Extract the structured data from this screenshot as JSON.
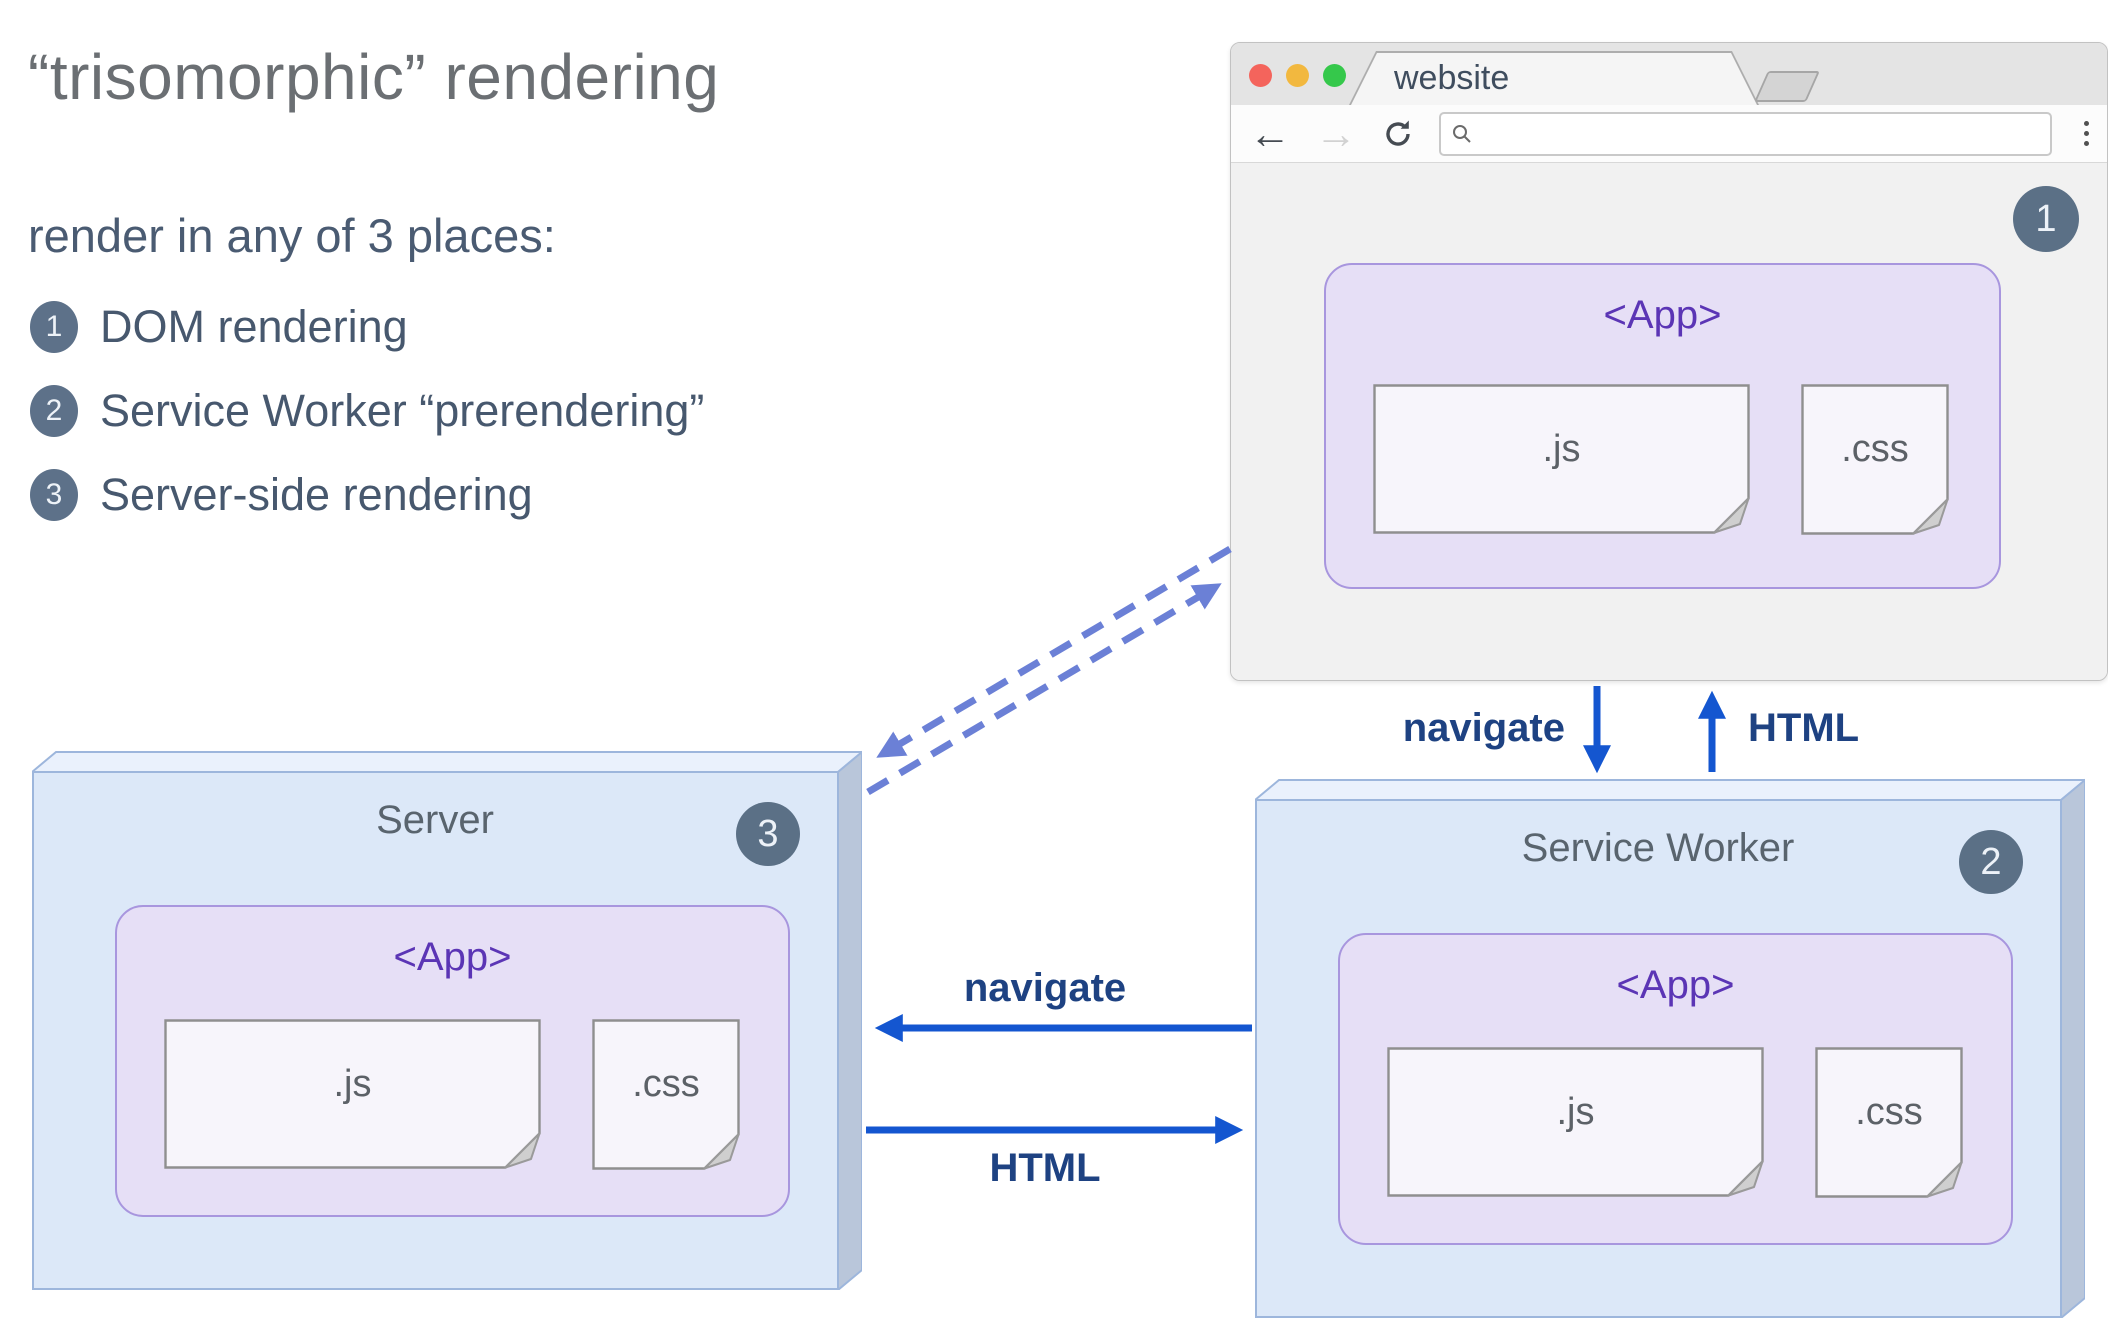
{
  "slide": {
    "title": "“trisomorphic” rendering",
    "intro": "render in any of 3 places:"
  },
  "legend": [
    {
      "num": "1",
      "label": "DOM rendering"
    },
    {
      "num": "2",
      "label": "Service Worker “prerendering”"
    },
    {
      "num": "3",
      "label": "Server-side rendering"
    }
  ],
  "browser": {
    "tab_title": "website",
    "badge": "1",
    "app": {
      "label": "<App>",
      "js": ".js",
      "css": ".css"
    }
  },
  "server": {
    "title": "Server",
    "badge": "3",
    "app": {
      "label": "<App>",
      "js": ".js",
      "css": ".css"
    }
  },
  "service_worker": {
    "title": "Service Worker",
    "badge": "2",
    "app": {
      "label": "<App>",
      "js": ".js",
      "css": ".css"
    }
  },
  "arrows": {
    "navigate_vertical": "navigate",
    "html_vertical": "HTML",
    "navigate_horizontal": "navigate",
    "html_horizontal": "HTML"
  },
  "colors": {
    "arrow_blue": "#1456d0",
    "arrow_label": "#1e4282",
    "dashed_blue": "#6b80d6",
    "badge_bg": "#5b7086",
    "app_purple_text": "#5b35b5",
    "app_fill": "#e6dff6",
    "app_border": "#a896de",
    "box_fill": "#dce8f8",
    "box_top_fill": "#eaf1fc",
    "box_side_fill": "#b9c6da",
    "browser_chrome": "#e4e4e4",
    "title_gray": "#6b6f73",
    "body_slate": "#47586e"
  }
}
